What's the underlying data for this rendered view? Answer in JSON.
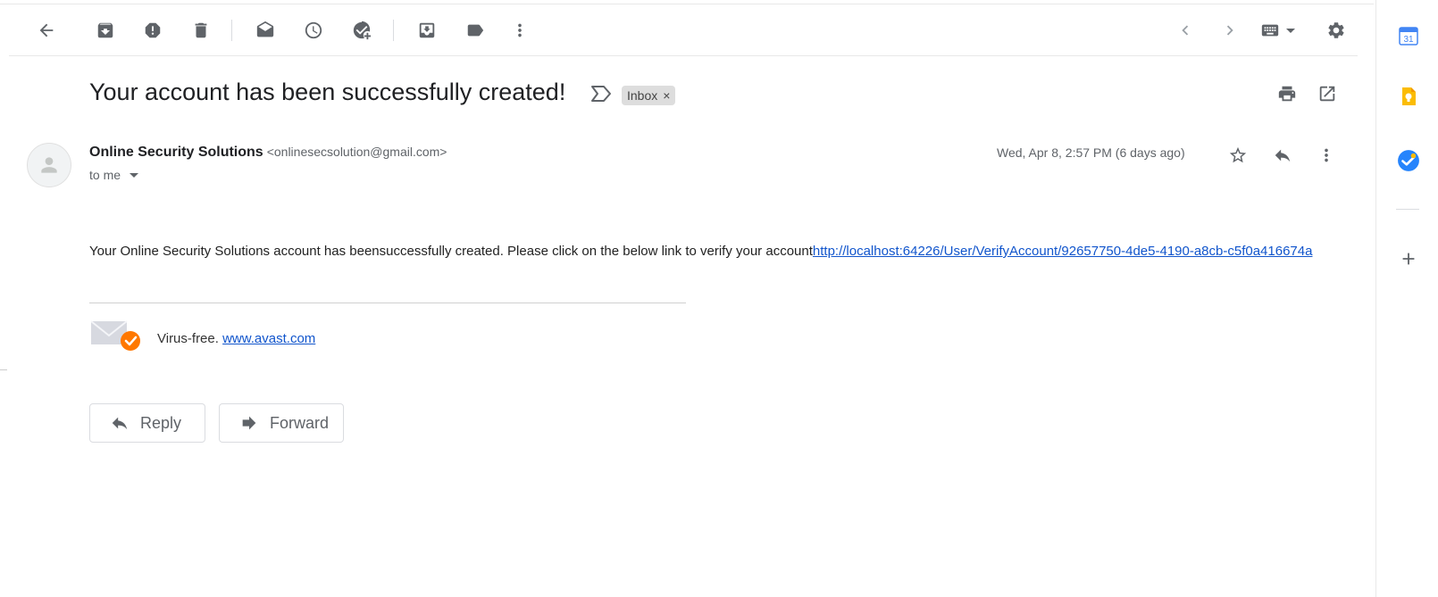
{
  "toolbar": {
    "back": "back-arrow-icon",
    "archive": "archive-icon",
    "spam": "report-spam-icon",
    "delete": "delete-icon",
    "mark_unread": "mark-unread-icon",
    "snooze": "snooze-icon",
    "add_task": "add-task-icon",
    "move_to": "move-to-icon",
    "labels": "label-icon",
    "more": "more-vert-icon",
    "older": "chevron-left-icon",
    "newer": "chevron-right-icon",
    "input_tools": "keyboard-icon",
    "settings": "gear-icon"
  },
  "email": {
    "subject": "Your account has been successfully created!",
    "label_chip": "Inbox",
    "chip_close": "×",
    "sender_name": "Online Security Solutions",
    "sender_email": "<onlinesecsolution@gmail.com>",
    "to": "to me",
    "date": "Wed, Apr 8, 2:57 PM (6 days ago)",
    "body_text": "Your Online Security Solutions account has beensuccessfully created. Please click on the below link to verify your account",
    "verify_link": "http://localhost:64226/User/VerifyAccount/92657750-4de5-4190-a8cb-c5f0a416674a",
    "virus_free_text": "Virus-free.",
    "avast_link": "www.avast.com"
  },
  "actions": {
    "reply": "Reply",
    "forward": "Forward"
  },
  "side_panel": {
    "calendar_day": "31",
    "items": [
      "calendar-icon",
      "keep-icon",
      "tasks-icon",
      "add-icon"
    ]
  },
  "colors": {
    "link": "#1155cc",
    "avast_orange": "#ff7800",
    "calendar_blue": "#4285f4",
    "keep_yellow": "#fbbc04"
  }
}
